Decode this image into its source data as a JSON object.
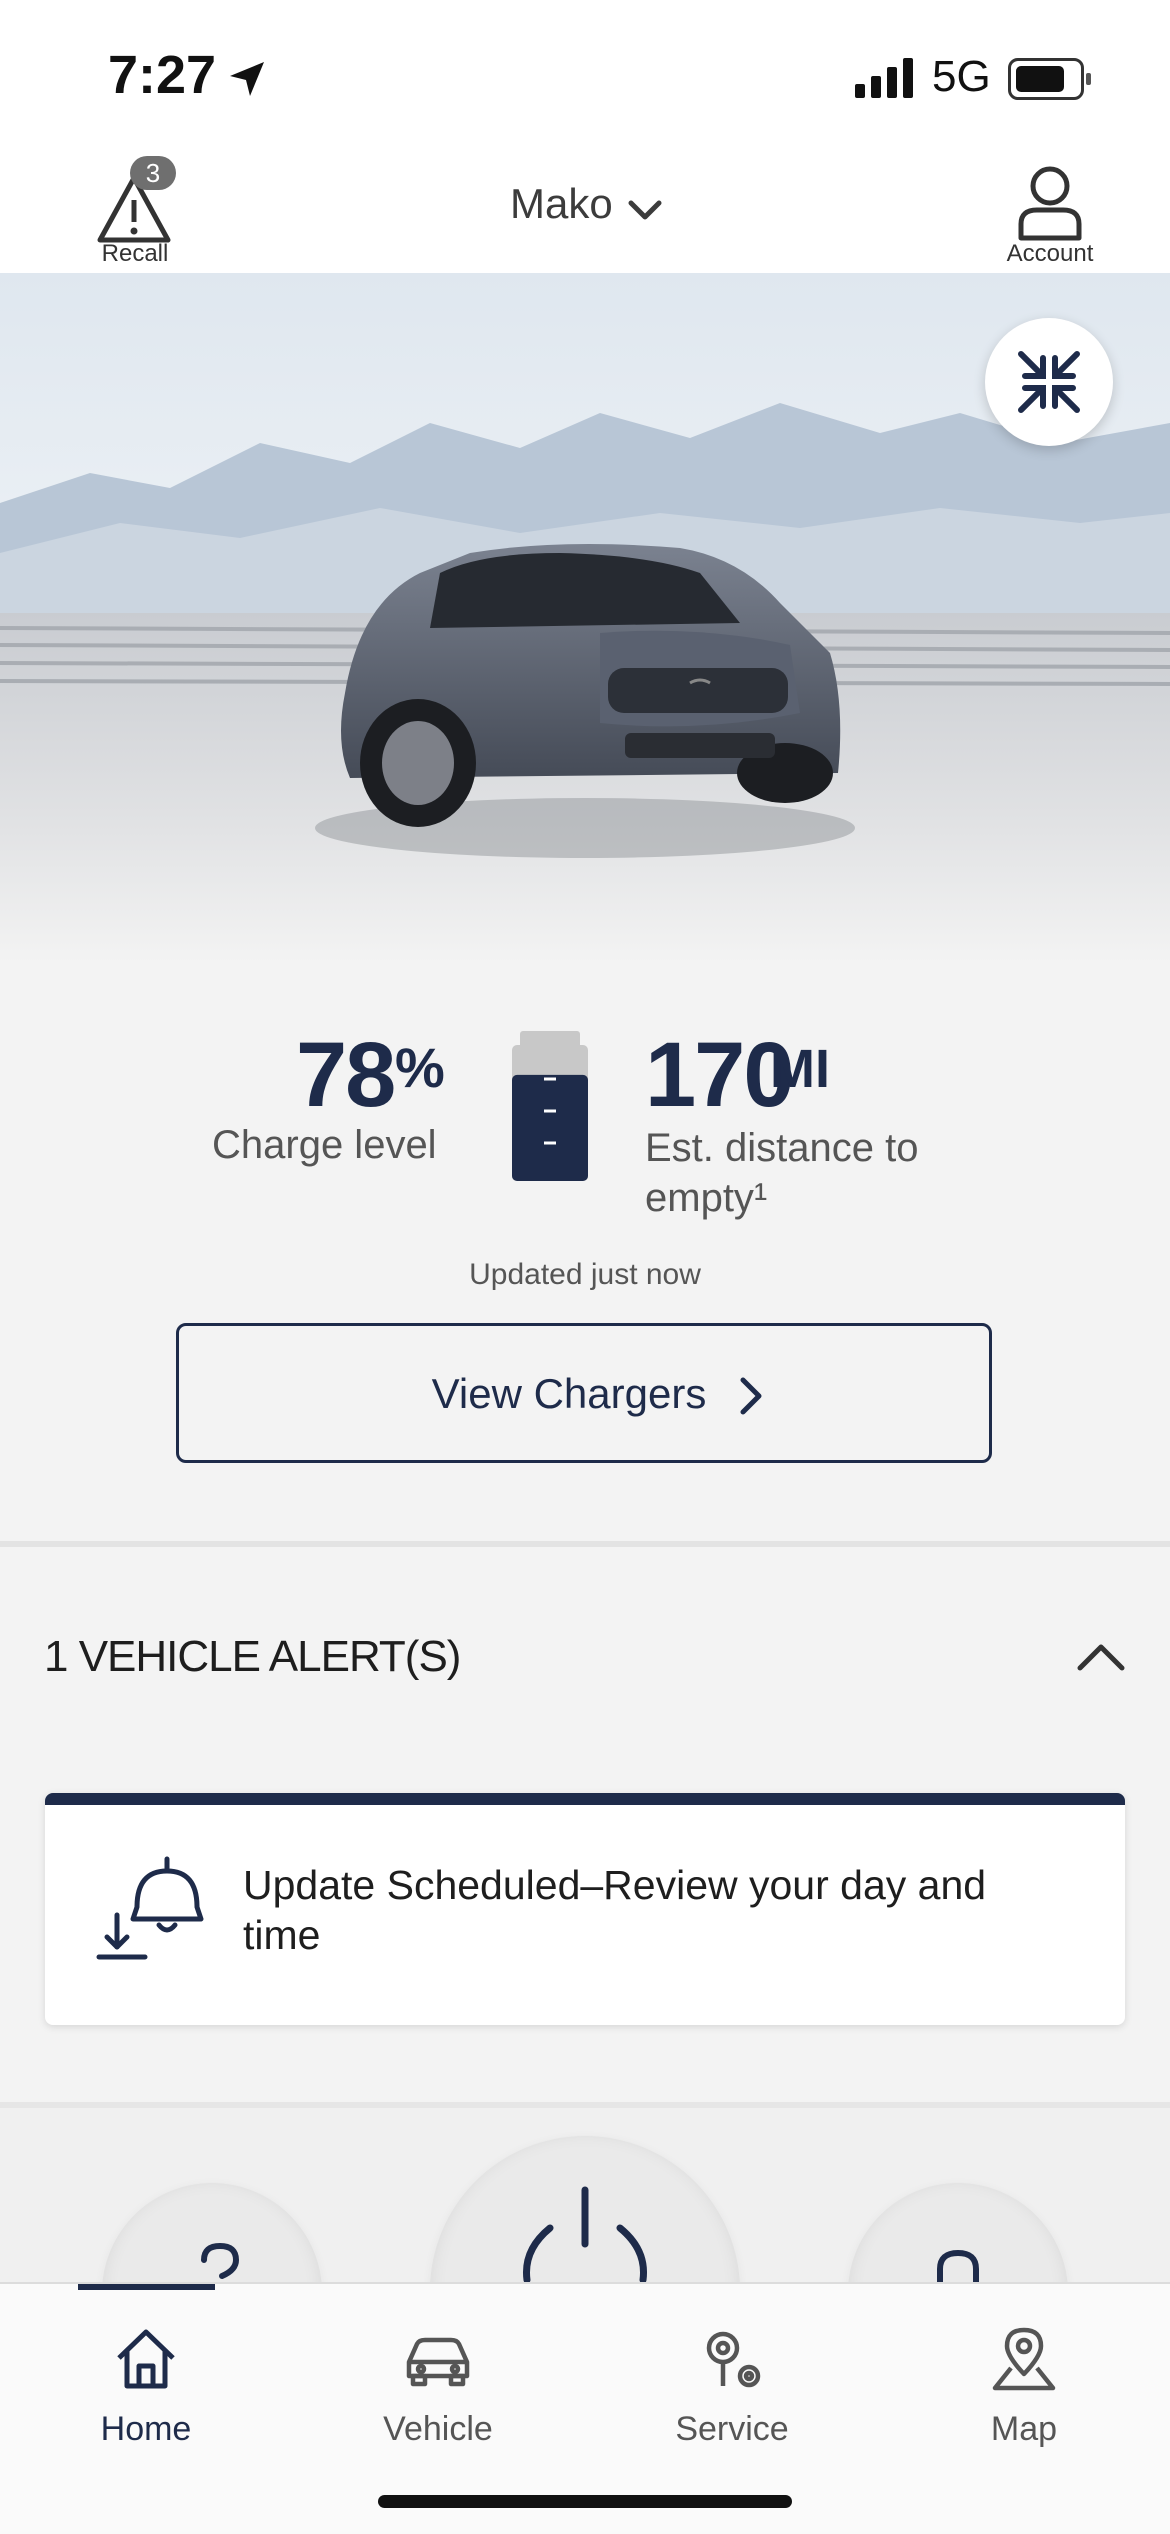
{
  "status_bar": {
    "time": "7:27",
    "network": "5G"
  },
  "header": {
    "recall": {
      "label": "Recall",
      "badge": "3"
    },
    "vehicle_name": "Mako",
    "account": {
      "label": "Account"
    }
  },
  "vehicle_status": {
    "charge_value": "78",
    "charge_unit": "%",
    "charge_label": "Charge level",
    "charge_fraction": 0.78,
    "distance_value": "170",
    "distance_unit": "MI",
    "distance_label": "Est. distance to empty¹",
    "updated": "Updated just now",
    "view_chargers_label": "View Chargers"
  },
  "alerts": {
    "title": "1 VEHICLE ALERT(S)",
    "items": [
      {
        "text": "Update Scheduled–Review your day and time"
      }
    ]
  },
  "tabs": [
    {
      "label": "Home",
      "icon": "home-icon",
      "active": true
    },
    {
      "label": "Vehicle",
      "icon": "car-icon",
      "active": false
    },
    {
      "label": "Service",
      "icon": "gears-icon",
      "active": false
    },
    {
      "label": "Map",
      "icon": "map-pin-icon",
      "active": false
    }
  ],
  "colors": {
    "primary": "#1e2b4a",
    "background": "#f3f3f3"
  }
}
